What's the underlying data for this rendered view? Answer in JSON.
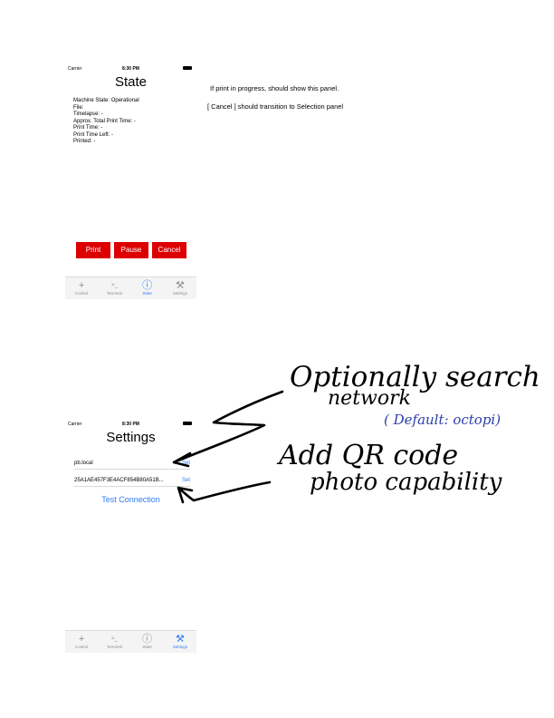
{
  "status_bar": {
    "carrier": "Carrier",
    "time": "8:30 PM"
  },
  "state_screen": {
    "title": "State",
    "info": [
      "Machine State: Operational",
      "File:",
      "Timelapse: -",
      "Approx. Total Print Time: -",
      "Print Time: -",
      "Print Time Left: -",
      "Printed: -"
    ],
    "buttons": {
      "print": "Print",
      "pause": "Pause",
      "cancel": "Cancel"
    },
    "active_tab": "State"
  },
  "settings_screen": {
    "title": "Settings",
    "host_value": "pb.local",
    "api_key_value": "25A1AE457F3E4ACF854B80A51B...",
    "set_label": "Set",
    "test_connection": "Test Connection",
    "active_tab": "Settings"
  },
  "tabs": [
    {
      "label": "Control",
      "icon": "plus-icon"
    },
    {
      "label": "Terminal",
      "icon": "terminal-icon"
    },
    {
      "label": "State",
      "icon": "info-icon"
    },
    {
      "label": "Settings",
      "icon": "wrench-icon"
    }
  ],
  "notes": {
    "line1": "If print in progress, should show this panel.",
    "line2": "[ Cancel ] should transition to Selection panel"
  },
  "handwritten": {
    "line1": "Optionally search",
    "line2": "network",
    "default": "( Default: octopi)",
    "line3": "Add QR code",
    "line4": "photo capability"
  },
  "colors": {
    "button_red": "#dd0000",
    "ios_blue": "#2e7cf6",
    "ink_black": "#000000",
    "ink_blue": "#2b3ea8"
  }
}
